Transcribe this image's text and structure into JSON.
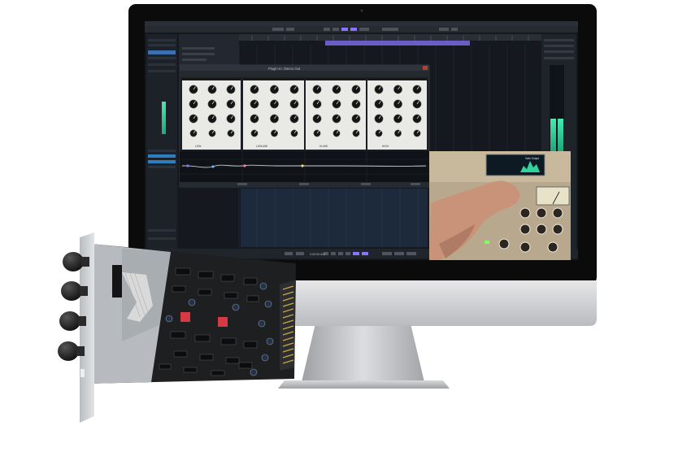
{
  "daw": {
    "plugin_window_title": "Plugin-In: Stereo Out",
    "eq_band_labels": [
      "LOW",
      "LOW-MID",
      "HI-MID",
      "HIGH"
    ],
    "transport_time": "0:00:00.000"
  },
  "video_overlay": {
    "meter_label": "Gain Output"
  },
  "colors": {
    "screen_bg": "#15191f",
    "plugin_panel": "#e9eae6",
    "meter_green": "#2fd49a",
    "loop_purple": "#8a74ff",
    "pcb": "#1e1f21",
    "faceplate": "#cfd3d7",
    "monitor_silver": "#c9cbcd"
  }
}
